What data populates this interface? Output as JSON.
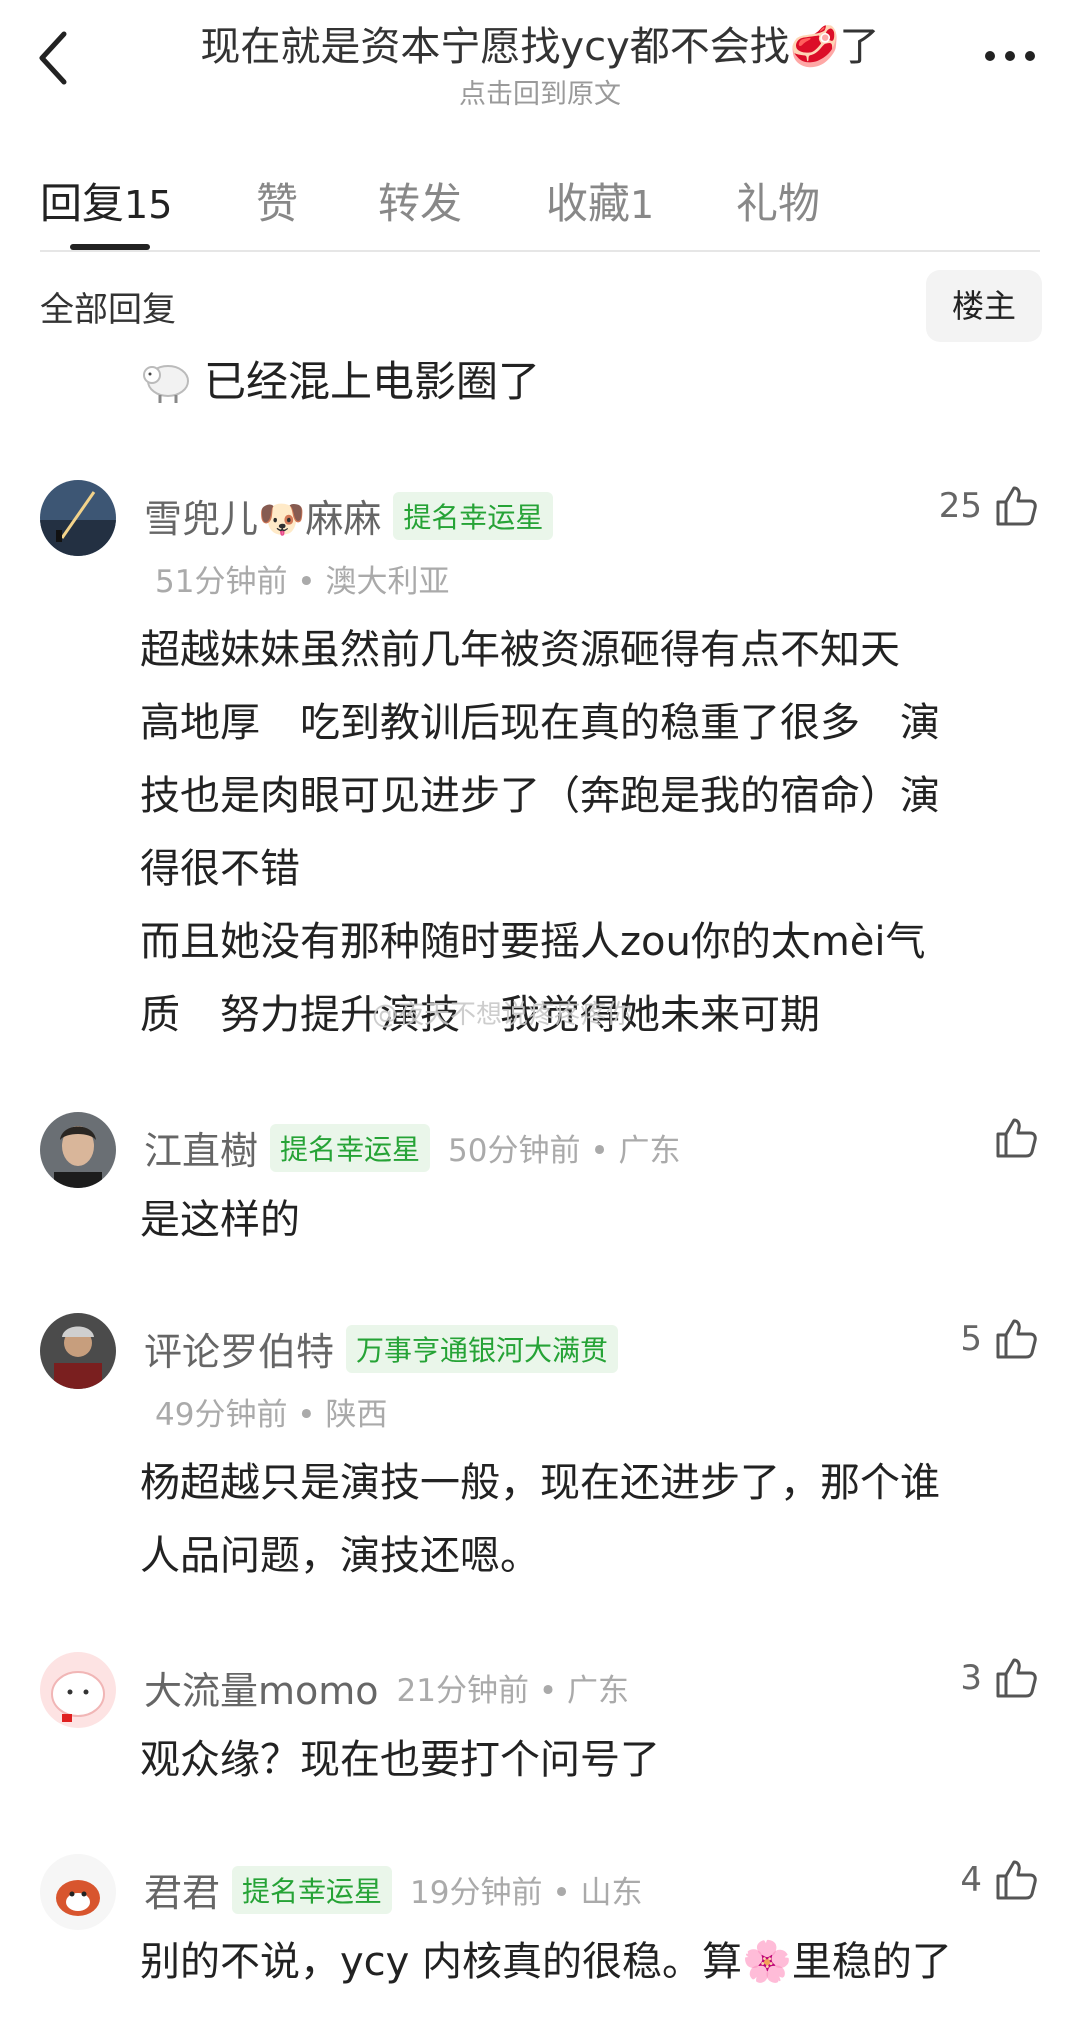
{
  "header": {
    "title": "现在就是资本宁愿找ycy都不会找🥩了",
    "subtitle": "点击回到原文"
  },
  "tabs": [
    {
      "label": "回复",
      "count": "15"
    },
    {
      "label": "赞",
      "count": ""
    },
    {
      "label": "转发",
      "count": ""
    },
    {
      "label": "收藏",
      "count": "1"
    },
    {
      "label": "礼物",
      "count": ""
    }
  ],
  "section": {
    "all_replies": "全部回复",
    "louzhu": "楼主"
  },
  "partial_comment": {
    "text": "已经混上电影圈了"
  },
  "comments": [
    {
      "name": "雪兜儿🐶麻麻",
      "badge": "提名幸运星",
      "likes": "25",
      "meta": "51分钟前 • 澳大利亚",
      "lines": [
        "超越妹妹虽然前几年被资源砸得有点不知天",
        "高地厚　吃到教训后现在真的稳重了很多　演",
        "技也是肉眼可见进步了（奔跑是我的宿命）演",
        "得很不错",
        "而且她没有那种随时要摇人zou你的太mèi气",
        "质　努力提升演技　我觉得她未来可期"
      ]
    },
    {
      "name": "江直樹",
      "badge": "提名幸运星",
      "likes": "",
      "meta": "50分钟前 • 广东",
      "lines": [
        "是这样的"
      ]
    },
    {
      "name": "评论罗伯特",
      "badge": "万事亨通银河大满贯",
      "likes": "5",
      "meta": "49分钟前 • 陕西",
      "lines": [
        "杨超越只是演技一般，现在还进步了，那个谁",
        "人品问题，演技还嗯。"
      ]
    },
    {
      "name": "大流量momo",
      "badge": "",
      "likes": "3",
      "meta": "21分钟前 • 广东",
      "lines": [
        "观众缘？现在也要打个问号了"
      ]
    },
    {
      "name": "君君",
      "badge": "提名幸运星",
      "likes": "4",
      "meta": "19分钟前 • 山东",
      "lines": [
        "别的不说，ycy 内核真的很稳。算🌸里稳的了"
      ]
    }
  ],
  "watermark": "@夜天不想说疼疼疼你"
}
